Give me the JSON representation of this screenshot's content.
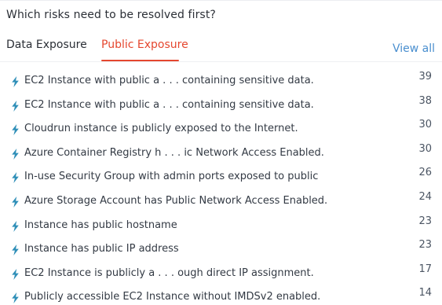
{
  "header": {
    "title": "Which risks need to be resolved first?"
  },
  "tabs": [
    {
      "label": "Data Exposure",
      "active": false
    },
    {
      "label": "Public Exposure",
      "active": true
    }
  ],
  "view_all_label": "View all",
  "colors": {
    "accent": "#e5472f",
    "link": "#4a8fcf",
    "bolt_icon": "#2f8fb8"
  },
  "risks": [
    {
      "icon": "lightning-bolt-icon",
      "label": "EC2 Instance with public a . . . containing sensitive data.",
      "count": "39"
    },
    {
      "icon": "lightning-bolt-icon",
      "label": "EC2 Instance with public a . . . containing sensitive data.",
      "count": "38"
    },
    {
      "icon": "lightning-bolt-icon",
      "label": "Cloudrun instance is publicly exposed to the Internet.",
      "count": "30"
    },
    {
      "icon": "lightning-bolt-icon",
      "label": "Azure Container Registry h . . . ic Network Access Enabled.",
      "count": "30"
    },
    {
      "icon": "lightning-bolt-icon",
      "label": "In-use Security Group with admin ports exposed to public",
      "count": "26"
    },
    {
      "icon": "lightning-bolt-icon",
      "label": "Azure Storage Account has Public Network Access Enabled.",
      "count": "24"
    },
    {
      "icon": "lightning-bolt-icon",
      "label": "Instance has public hostname",
      "count": "23"
    },
    {
      "icon": "lightning-bolt-icon",
      "label": "Instance has public IP address",
      "count": "23"
    },
    {
      "icon": "lightning-bolt-icon",
      "label": "EC2 Instance is publicly a . . . ough direct IP assignment.",
      "count": "17"
    },
    {
      "icon": "lightning-bolt-icon",
      "label": "Publicly accessible EC2 Instance without IMDSv2 enabled.",
      "count": "14"
    }
  ]
}
